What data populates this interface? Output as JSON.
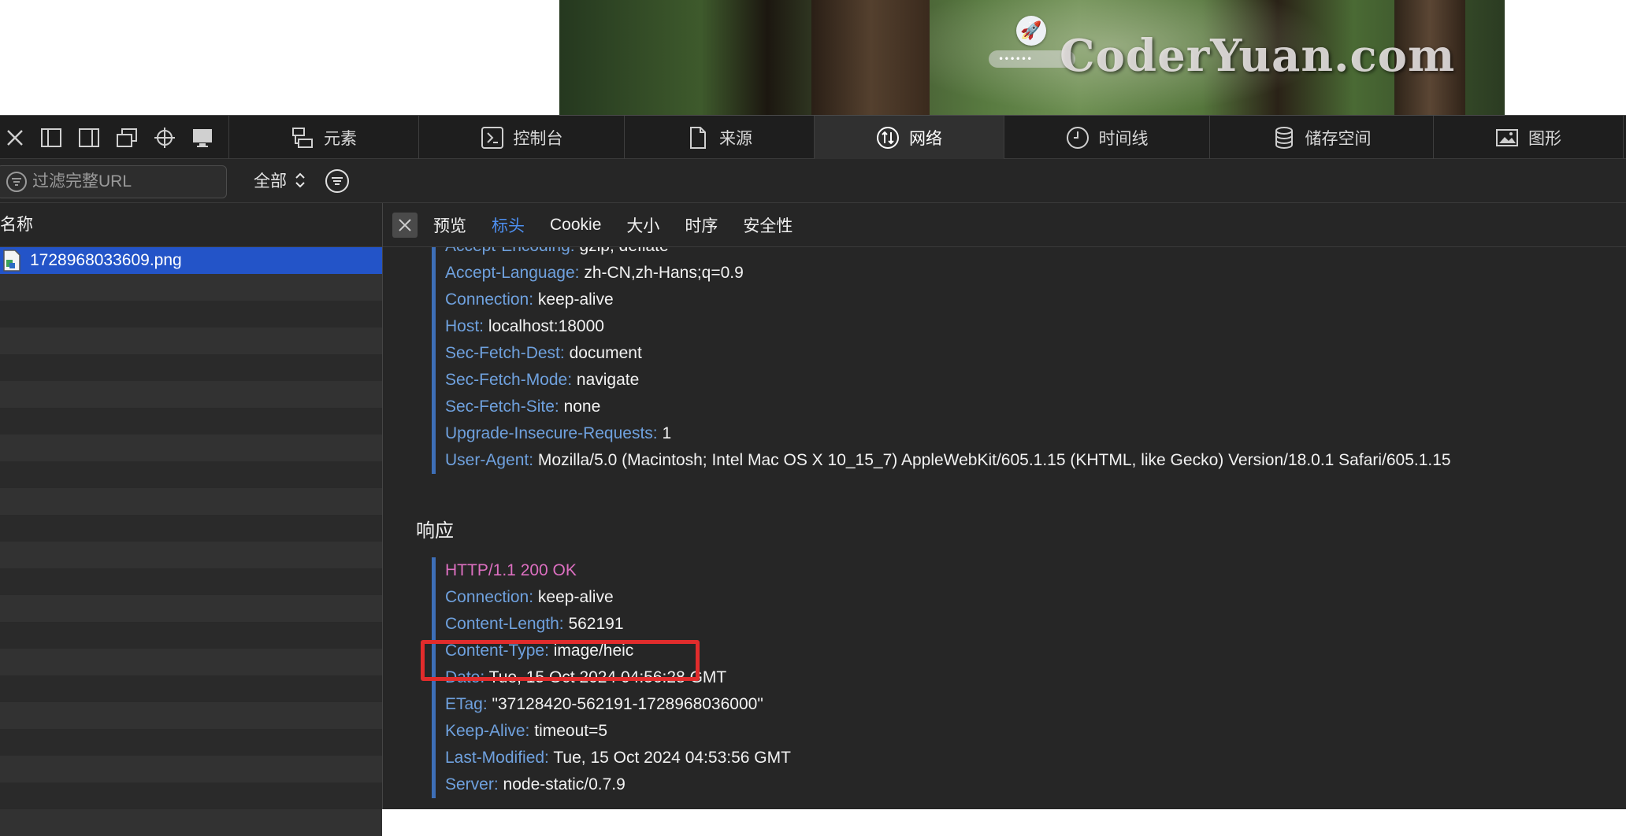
{
  "page": {
    "watermark": "CoderYuan.com",
    "password_dots": "••••••"
  },
  "devtools": {
    "tabs": [
      {
        "label": "元素"
      },
      {
        "label": "控制台"
      },
      {
        "label": "来源"
      },
      {
        "label": "网络"
      },
      {
        "label": "时间线"
      },
      {
        "label": "储存空间"
      },
      {
        "label": "图形"
      }
    ],
    "active_tab": "网络",
    "filter": {
      "placeholder": "过滤完整URL",
      "scope": "全部"
    },
    "list": {
      "header": "名称",
      "selected_file": "1728968033609.png"
    },
    "subtabs": [
      {
        "label": "预览"
      },
      {
        "label": "标头"
      },
      {
        "label": "Cookie"
      },
      {
        "label": "大小"
      },
      {
        "label": "时序"
      },
      {
        "label": "安全性"
      }
    ],
    "request_headers": [
      {
        "key": "Accept-Encoding:",
        "value": "gzip, deflate"
      },
      {
        "key": "Accept-Language:",
        "value": "zh-CN,zh-Hans;q=0.9"
      },
      {
        "key": "Connection:",
        "value": "keep-alive"
      },
      {
        "key": "Host:",
        "value": "localhost:18000"
      },
      {
        "key": "Sec-Fetch-Dest:",
        "value": "document"
      },
      {
        "key": "Sec-Fetch-Mode:",
        "value": "navigate"
      },
      {
        "key": "Sec-Fetch-Site:",
        "value": "none"
      },
      {
        "key": "Upgrade-Insecure-Requests:",
        "value": "1"
      },
      {
        "key": "User-Agent:",
        "value": "Mozilla/5.0 (Macintosh; Intel Mac OS X 10_15_7) AppleWebKit/605.1.15 (KHTML, like Gecko) Version/18.0.1 Safari/605.1.15"
      }
    ],
    "response_title": "响应",
    "response_status": "HTTP/1.1 200 OK",
    "response_headers": [
      {
        "key": "Connection:",
        "value": "keep-alive"
      },
      {
        "key": "Content-Length:",
        "value": "562191"
      },
      {
        "key": "Content-Type:",
        "value": "image/heic"
      },
      {
        "key": "Date:",
        "value": "Tue, 15 Oct 2024 04:56:28 GMT"
      },
      {
        "key": "ETag:",
        "value": "\"37128420-562191-1728968036000\""
      },
      {
        "key": "Keep-Alive:",
        "value": "timeout=5"
      },
      {
        "key": "Last-Modified:",
        "value": "Tue, 15 Oct 2024 04:53:56 GMT"
      },
      {
        "key": "Server:",
        "value": "node-static/0.7.9"
      }
    ]
  }
}
